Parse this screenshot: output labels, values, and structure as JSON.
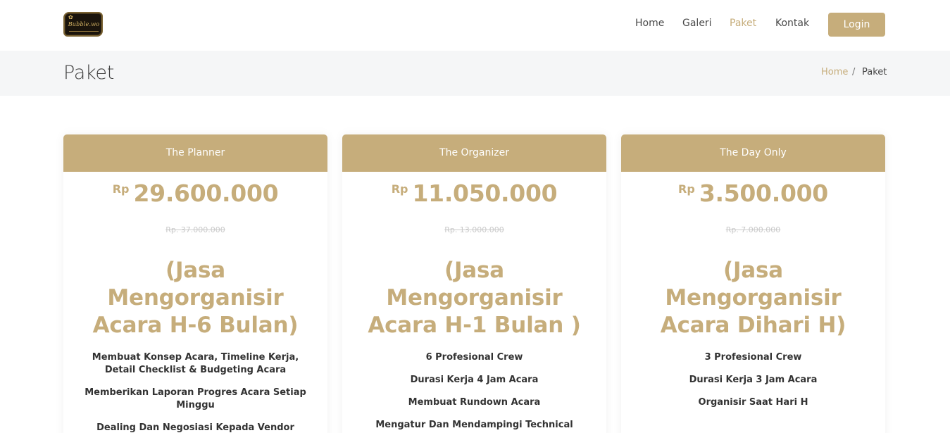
{
  "logo": {
    "text": "Bubble.wo"
  },
  "nav": {
    "items": [
      "Home",
      "Galeri",
      "Paket",
      "Kontak"
    ],
    "active": "Paket",
    "login_label": "Login"
  },
  "page": {
    "title": "Paket",
    "breadcrumb": [
      "Home",
      "/",
      "Paket"
    ]
  },
  "colors": {
    "accent": "#c6ad7b",
    "band": "#f5f6f7"
  },
  "cards": [
    {
      "name": "The Planner",
      "currency": "Rp",
      "price": "29.600.000",
      "old_price": "Rp. 37.000.000",
      "service": "(Jasa Mengorganisir Acara H-6 Bulan)",
      "features": [
        "Membuat Konsep Acara, Timeline Kerja, Detail Checklist & Budgeting Acara",
        "Memberikan Laporan Progres Acara Setiap Minggu",
        "Dealing Dan Negosiasi Kepada Vendor"
      ]
    },
    {
      "name": "The Organizer",
      "currency": "Rp",
      "price": "11.050.000",
      "old_price": "Rp. 13.000.000",
      "service": "(Jasa Mengorganisir Acara H-1 Bulan )",
      "features": [
        "6 Profesional Crew",
        "Durasi Kerja 4 Jam Acara",
        "Membuat Rundown Acara",
        "Mengatur Dan Mendampingi Technical Meeting"
      ]
    },
    {
      "name": "The Day Only",
      "currency": "Rp",
      "price": "3.500.000",
      "old_price": "Rp. 7.000.000",
      "service": "(Jasa Mengorganisir Acara Dihari H)",
      "features": [
        "3 Profesional Crew",
        "Durasi Kerja 3 Jam Acara",
        "Organisir Saat Hari H"
      ]
    }
  ]
}
